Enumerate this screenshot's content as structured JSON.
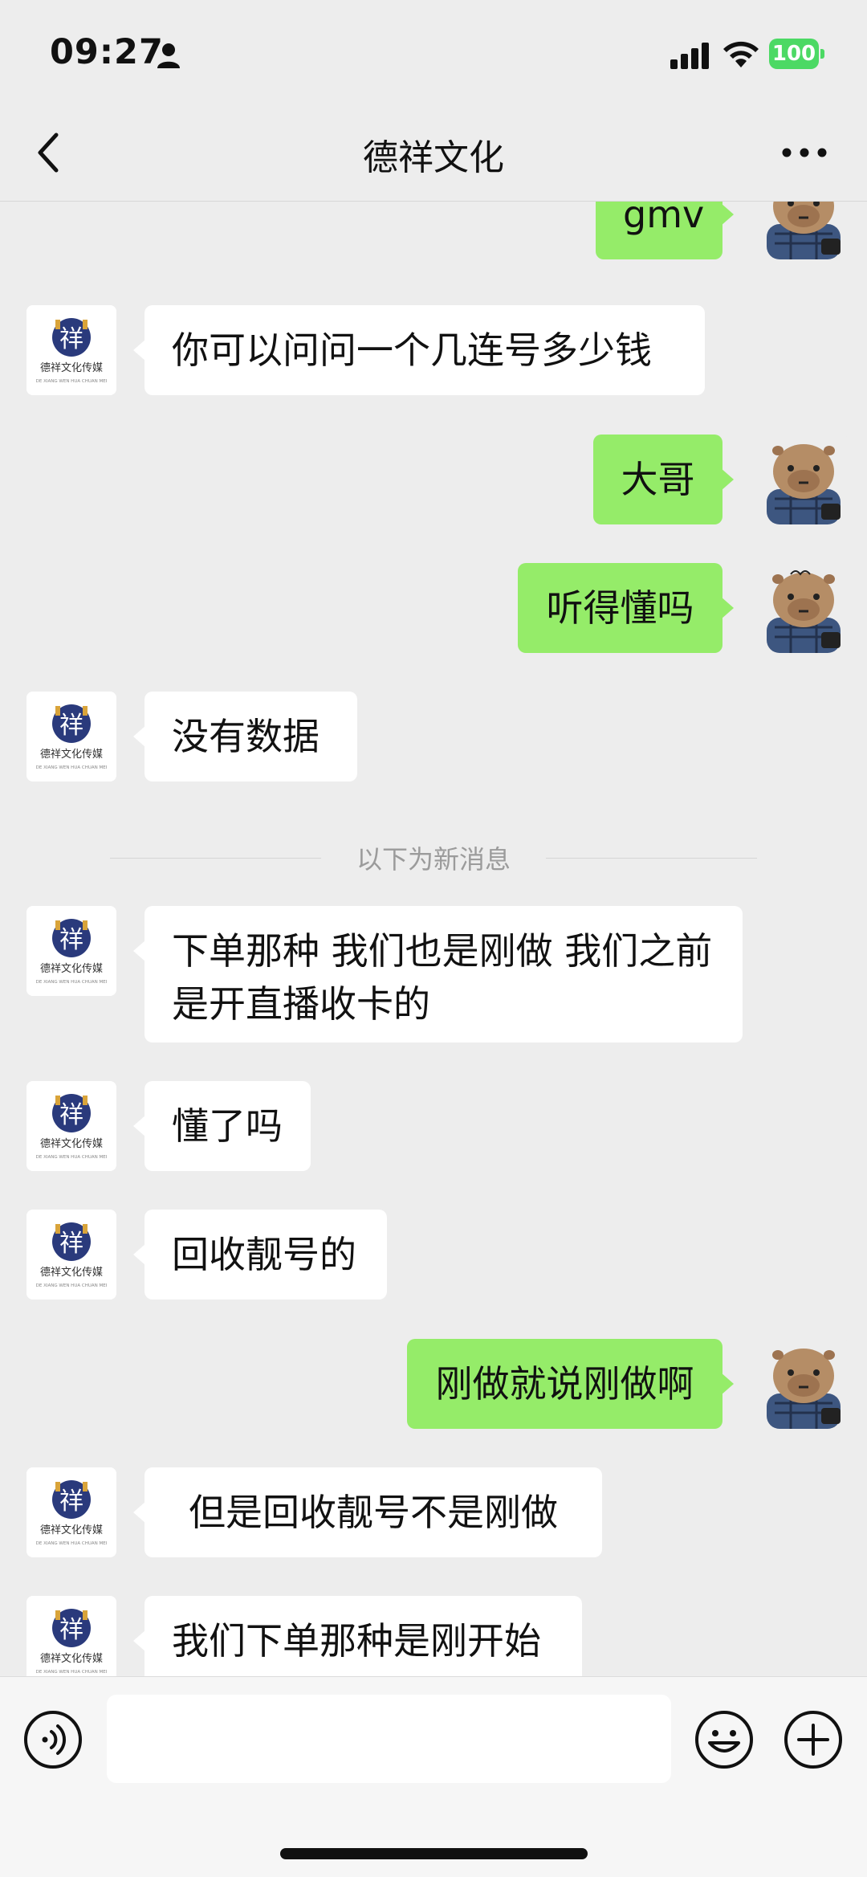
{
  "status_bar": {
    "time": "09:27",
    "battery": "100"
  },
  "header": {
    "title": "德祥文化"
  },
  "chat": {
    "divider_text": "以下为新消息",
    "messages": [
      {
        "side": "right",
        "text": "gmv"
      },
      {
        "side": "left",
        "text": "你可以问问一个几连号多少钱"
      },
      {
        "side": "right",
        "text": "大哥"
      },
      {
        "side": "right",
        "text": "听得懂吗"
      },
      {
        "side": "left",
        "text": "没有数据"
      },
      {
        "side": "left",
        "text": "下单那种 我们也是刚做 我们之前是开直播收卡的"
      },
      {
        "side": "left",
        "text": "懂了吗"
      },
      {
        "side": "left",
        "text": "回收靓号的"
      },
      {
        "side": "right",
        "text": "刚做就说刚做啊"
      },
      {
        "side": "left",
        "text": "但是回收靓号不是刚做"
      },
      {
        "side": "left",
        "text": "我们下单那种是刚开始"
      }
    ]
  },
  "contact_avatar": {
    "logo_char": "祥",
    "name": "德祥文化传媒",
    "subtitle": "DE XIANG WEN HUA CHUAN MEI"
  },
  "input": {
    "value": ""
  },
  "colors": {
    "sent_bubble": "#95ec69",
    "received_bubble": "#ffffff",
    "background": "#ededed",
    "battery": "#4cd964"
  }
}
